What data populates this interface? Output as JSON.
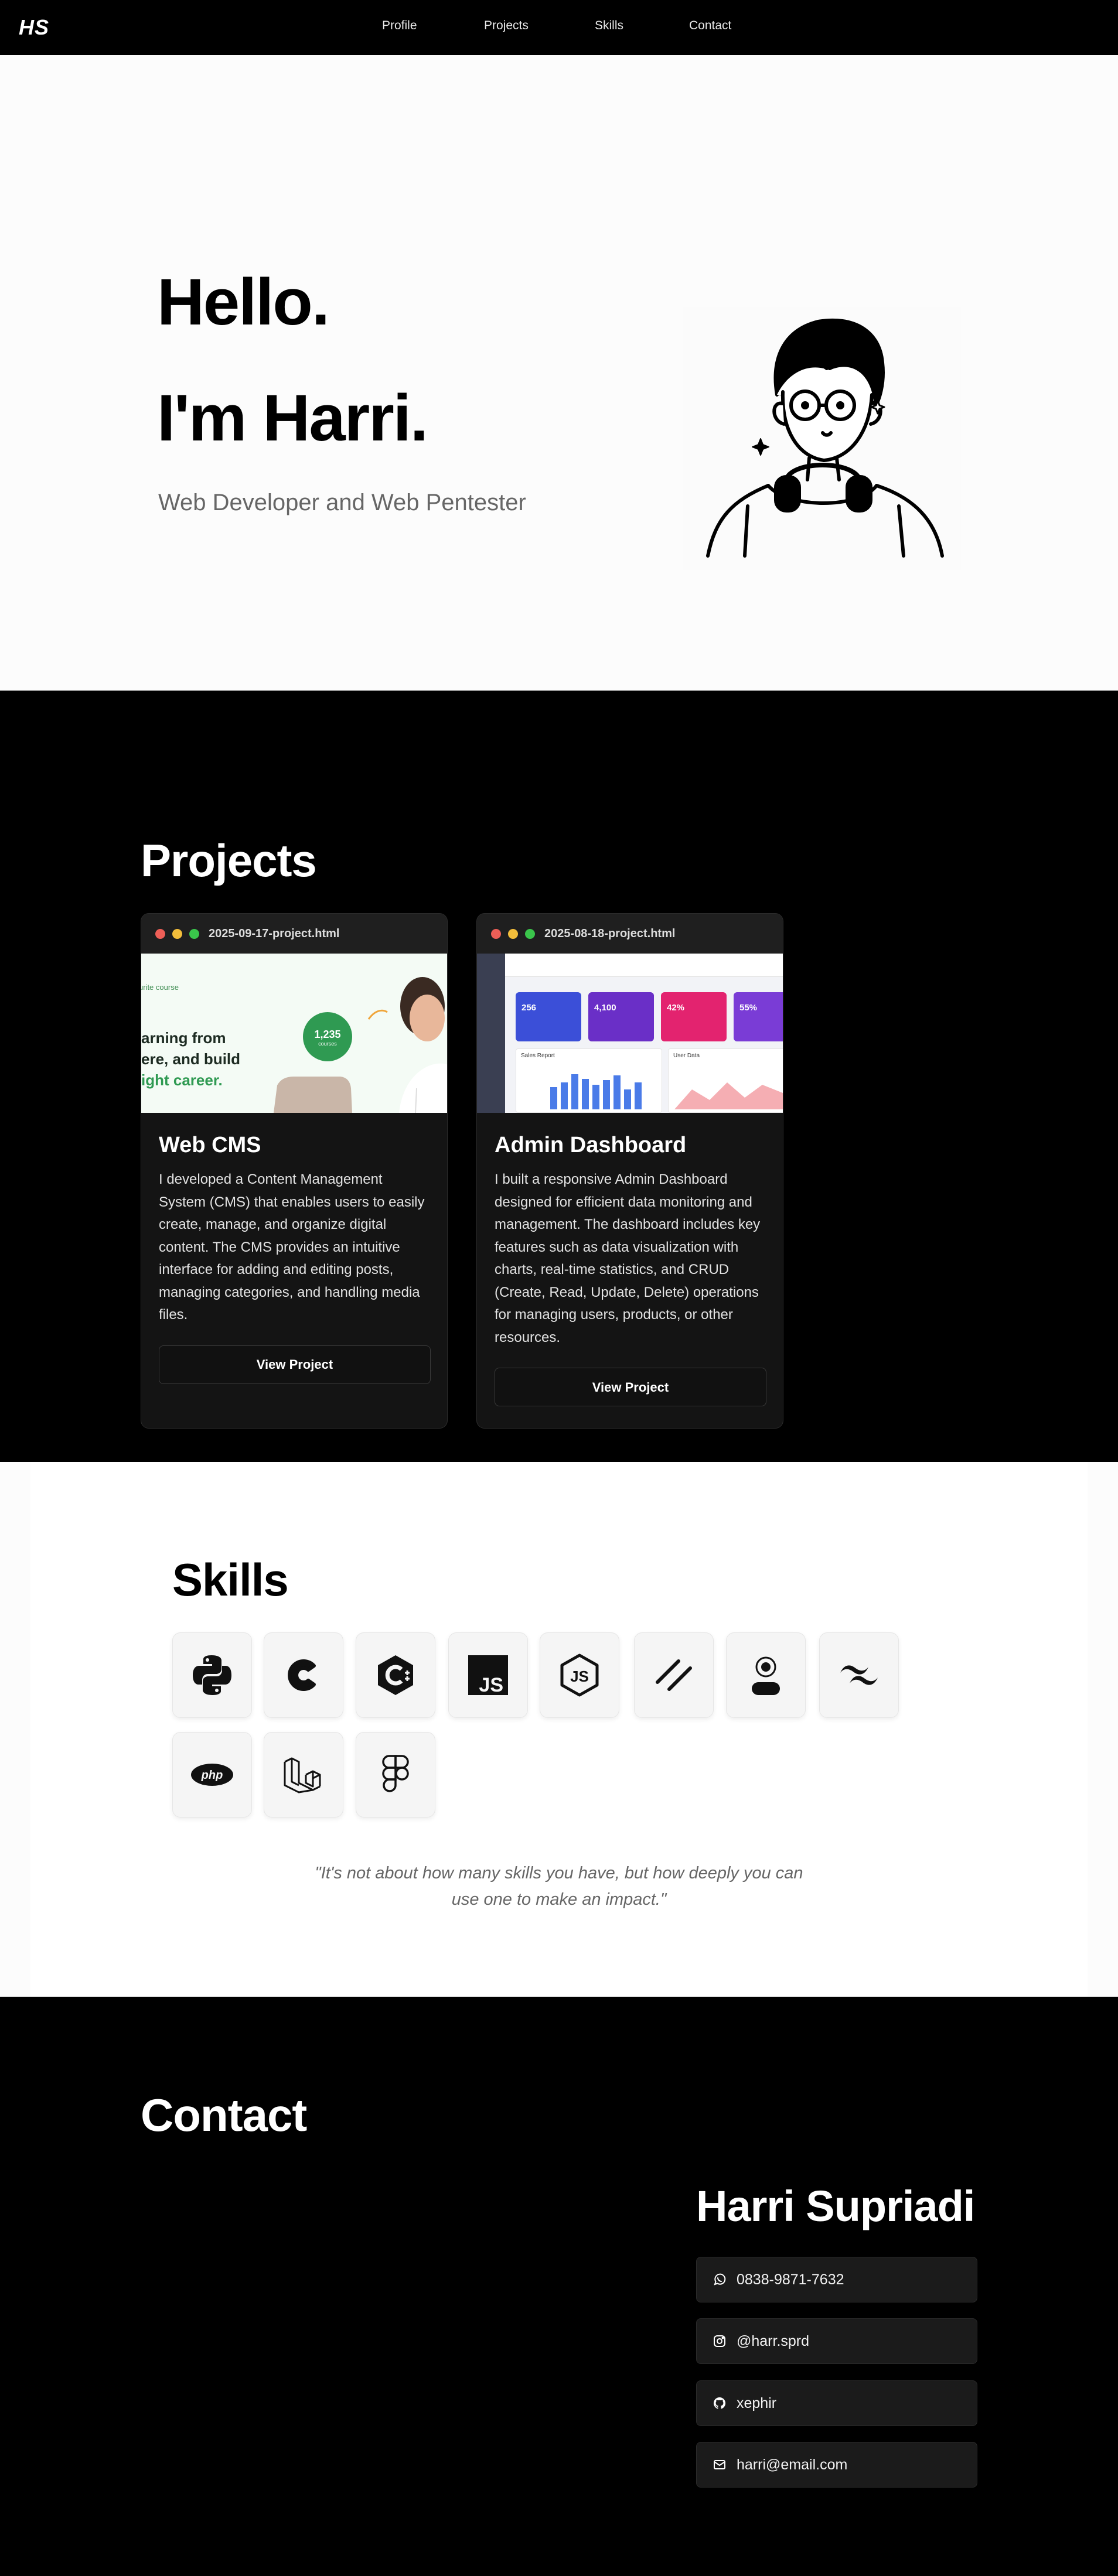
{
  "nav": {
    "logo": "HS",
    "links": [
      "Profile",
      "Projects",
      "Skills",
      "Contact"
    ]
  },
  "hero": {
    "line1": "Hello.",
    "line2": "I'm Harri.",
    "subtitle": "Web Developer and Web Pentester",
    "image_icon": "portrait-illustration"
  },
  "projects": {
    "title": "Projects",
    "cards": [
      {
        "file": "2025-09-17-project.html",
        "title": "Web CMS",
        "description": "I developed a Content Management System (CMS) that enables users to easily create, manage, and organize digital content. The CMS provides an intuitive interface for adding and editing posts, managing categories, and handling media files.",
        "button": "View Project",
        "preview": {
          "lines": [
            "arning from",
            "ere, and build",
            "ight career."
          ],
          "small_top": "urite course",
          "badge_value": "1,235",
          "badge_label": "courses"
        }
      },
      {
        "file": "2025-08-18-project.html",
        "title": "Admin Dashboard",
        "description": "I built a responsive Admin Dashboard designed for efficient data monitoring and management. The dashboard includes key features such as data visualization with charts, real-time statistics, and CRUD (Create, Read, Update, Delete) operations for managing users, products, or other resources.",
        "button": "View Project",
        "preview": {
          "stats": [
            "256",
            "4,100",
            "42%",
            "55%"
          ],
          "labels": [
            "Sales Report",
            "User Data"
          ]
        }
      }
    ]
  },
  "skills": {
    "title": "Skills",
    "items": [
      "python-icon",
      "c-icon",
      "cpp-icon",
      "javascript-icon",
      "nodejs-icon",
      "slash-icon",
      "user-icon",
      "tailwind-icon",
      "php-icon",
      "laravel-icon",
      "figma-icon"
    ],
    "quote": "\"It's not about how many skills you have, but how deeply you can use one to make an impact.\""
  },
  "contact": {
    "title": "Contact",
    "name": "Harri Supriadi",
    "items": [
      {
        "icon": "whatsapp-icon",
        "text": "0838-9871-7632"
      },
      {
        "icon": "instagram-icon",
        "text": "@harr.sprd"
      },
      {
        "icon": "github-icon",
        "text": "xephir"
      },
      {
        "icon": "mail-icon",
        "text": "harri@email.com"
      }
    ]
  }
}
